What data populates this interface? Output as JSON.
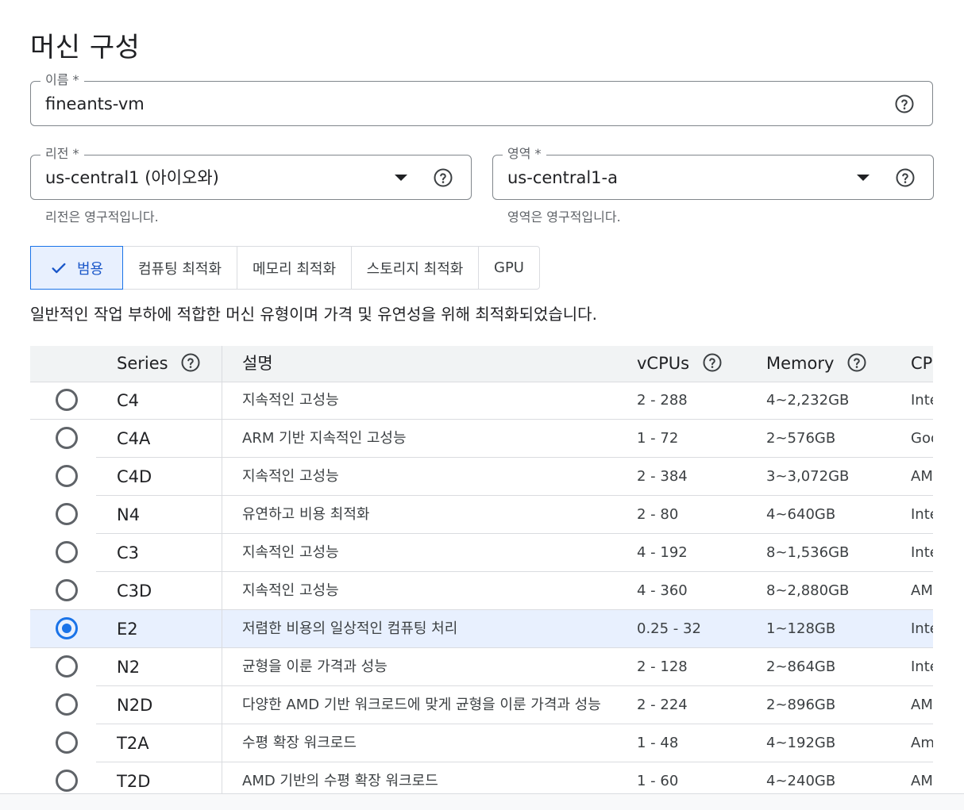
{
  "page": {
    "title": "머신 구성"
  },
  "name_field": {
    "label": "이름 *",
    "value": "fineants-vm"
  },
  "region_field": {
    "label": "리전 *",
    "value": "us-central1 (아이오와)",
    "hint": "리전은 영구적입니다."
  },
  "zone_field": {
    "label": "영역 *",
    "value": "us-central1-a",
    "hint": "영역은 영구적입니다."
  },
  "tabs": [
    {
      "label": "범용",
      "active": true
    },
    {
      "label": "컴퓨팅 최적화",
      "active": false
    },
    {
      "label": "메모리 최적화",
      "active": false
    },
    {
      "label": "스토리지 최적화",
      "active": false
    },
    {
      "label": "GPU",
      "active": false
    }
  ],
  "tab_description": "일반적인 작업 부하에 적합한 머신 유형이며 가격 및 유연성을 위해 최적화되었습니다.",
  "table": {
    "headers": {
      "series": "Series",
      "description": "설명",
      "vcpus": "vCPUs",
      "memory": "Memory",
      "cpu": "CP"
    },
    "rows": [
      {
        "series": "C4",
        "description": "지속적인 고성능",
        "vcpus": "2 - 288",
        "memory": "4~2,232GB",
        "cpu": "Inte",
        "selected": false
      },
      {
        "series": "C4A",
        "description": "ARM 기반 지속적인 고성능",
        "vcpus": "1 - 72",
        "memory": "2~576GB",
        "cpu": "Goo",
        "selected": false
      },
      {
        "series": "C4D",
        "description": "지속적인 고성능",
        "vcpus": "2 - 384",
        "memory": "3~3,072GB",
        "cpu": "AM",
        "selected": false
      },
      {
        "series": "N4",
        "description": "유연하고 비용 최적화",
        "vcpus": "2 - 80",
        "memory": "4~640GB",
        "cpu": "Inte",
        "selected": false
      },
      {
        "series": "C3",
        "description": "지속적인 고성능",
        "vcpus": "4 - 192",
        "memory": "8~1,536GB",
        "cpu": "Inte",
        "selected": false
      },
      {
        "series": "C3D",
        "description": "지속적인 고성능",
        "vcpus": "4 - 360",
        "memory": "8~2,880GB",
        "cpu": "AM",
        "selected": false
      },
      {
        "series": "E2",
        "description": "저렴한 비용의 일상적인 컴퓨팅 처리",
        "vcpus": "0.25 - 32",
        "memory": "1~128GB",
        "cpu": "Inte",
        "selected": true
      },
      {
        "series": "N2",
        "description": "균형을 이룬 가격과 성능",
        "vcpus": "2 - 128",
        "memory": "2~864GB",
        "cpu": "Inte",
        "selected": false
      },
      {
        "series": "N2D",
        "description": "다양한 AMD 기반 워크로드에 맞게 균형을 이룬 가격과 성능",
        "vcpus": "2 - 224",
        "memory": "2~896GB",
        "cpu": "AM",
        "selected": false
      },
      {
        "series": "T2A",
        "description": "수평 확장 워크로드",
        "vcpus": "1 - 48",
        "memory": "4~192GB",
        "cpu": "Am",
        "selected": false
      },
      {
        "series": "T2D",
        "description": "AMD 기반의 수평 확장 워크로드",
        "vcpus": "1 - 60",
        "memory": "4~240GB",
        "cpu": "AM",
        "selected": false
      }
    ]
  },
  "colors": {
    "accent": "#1a73e8",
    "selected_row": "#e8f0fe",
    "header_bg": "#f1f3f4",
    "border": "#dadce0"
  },
  "icons": {
    "help": "help-circle-icon",
    "dropdown": "dropdown-caret-icon",
    "check": "check-icon"
  }
}
